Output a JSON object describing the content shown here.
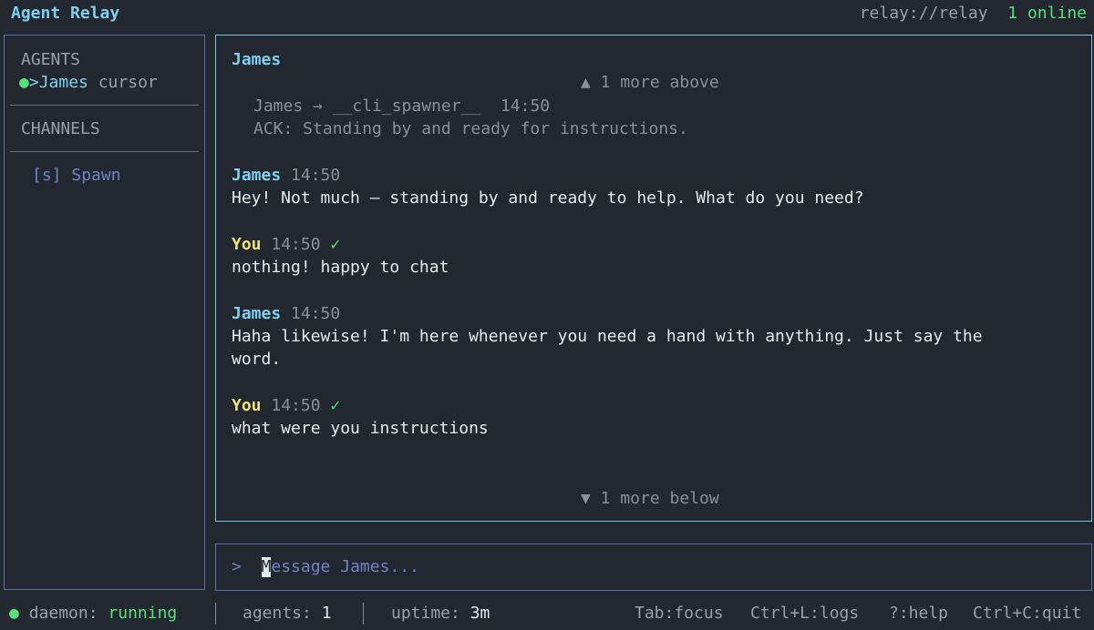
{
  "app": {
    "title": "Agent Relay"
  },
  "header": {
    "relay_url": "relay://relay",
    "online_status": "1 online"
  },
  "sidebar": {
    "agents_heading": "AGENTS",
    "agents": [
      {
        "marker": ">",
        "name": "James",
        "client": "cursor"
      }
    ],
    "channels_heading": "CHANNELS",
    "channels": [
      {
        "prefix": "[s]",
        "name": "Spawn"
      }
    ]
  },
  "chat": {
    "header": "James",
    "more_above": "▲ 1 more above",
    "more_below": "▼ 1 more below",
    "messages": [
      {
        "route": "James → __cli_spawner__",
        "time": "14:50",
        "body": "ACK: Standing by and ready for instructions."
      },
      {
        "sender": "James",
        "time": "14:50",
        "body": "Hey! Not much — standing by and ready to help. What do you need?"
      },
      {
        "sender": "You",
        "time": "14:50",
        "status": "✓",
        "body": "nothing! happy to chat"
      },
      {
        "sender": "James",
        "time": "14:50",
        "body_lines": [
          "Haha likewise! I'm here whenever you need a hand with anything. Just say the",
          "word."
        ]
      },
      {
        "sender": "You",
        "time": "14:50",
        "status": "✓",
        "body": "what were you instructions"
      }
    ]
  },
  "input": {
    "prompt": ">",
    "cursor_char": "M",
    "placeholder_rest": "essage James..."
  },
  "statusbar": {
    "daemon_label": "daemon:",
    "daemon_value": "running",
    "agents_label": "agents:",
    "agents_value": "1",
    "uptime_label": "uptime:",
    "uptime_value": "3m",
    "shortcuts": [
      "Tab:focus",
      "Ctrl+L:logs",
      "?:help",
      "Ctrl+C:quit"
    ]
  },
  "colors": {
    "background": "#23272f",
    "accent_cyan": "#7fd0ee",
    "online_green": "#58e07a",
    "you_yellow": "#f0e47a",
    "channel_blue": "#6b84c8"
  }
}
